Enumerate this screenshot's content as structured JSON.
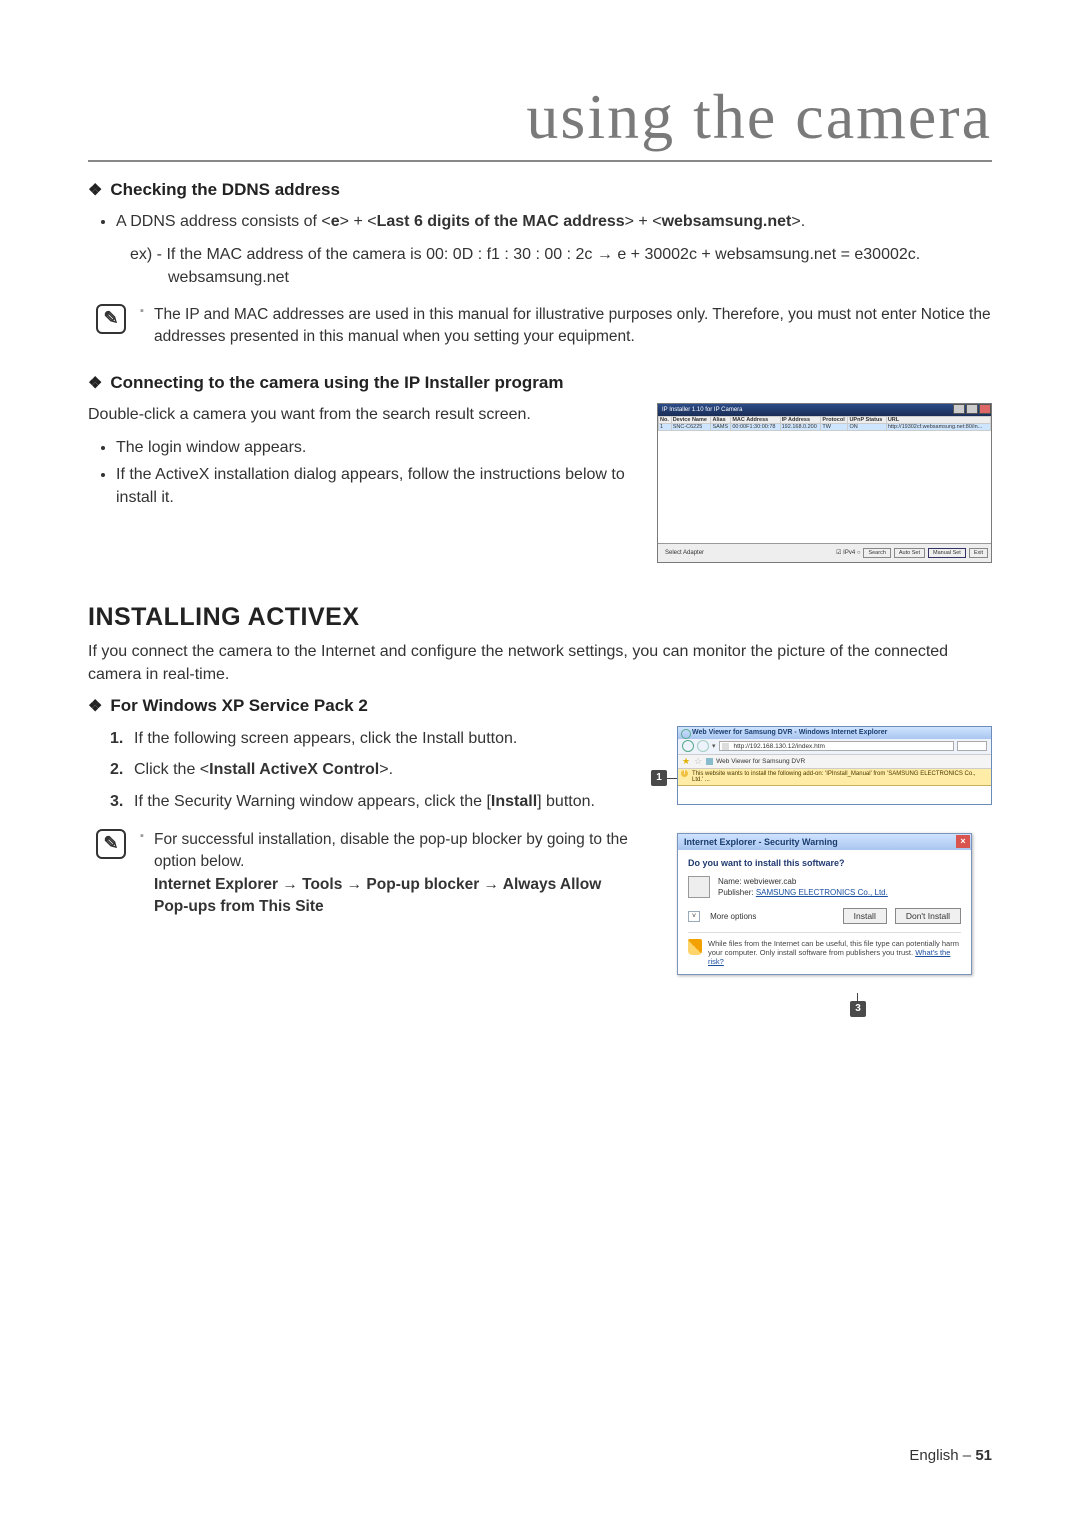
{
  "page": {
    "title": "using the camera",
    "footer_lang": "English –",
    "footer_page": "51"
  },
  "section_ddns": {
    "heading": "Checking the DDNS address",
    "bullet1_pre": "A DDNS address consists of <",
    "bullet1_e": "e",
    "bullet1_mid1": "> + <",
    "bullet1_last6": "Last 6 digits of the MAC address",
    "bullet1_mid2": "> + <",
    "bullet1_domain": "websamsung.net",
    "bullet1_post": ">.",
    "ex_line1": "ex) - If the MAC address of the camera is 00: 0D : f1 : 30 : 00 : 2c → e + 30002c + websamsung.net = e30002c.",
    "ex_line2": "websamsung.net",
    "note": "The IP and MAC addresses are used in this manual for illustrative purposes only. Therefore, you must not enter Notice the addresses presented in this manual when you setting your equipment."
  },
  "section_connect": {
    "heading": "Connecting to the camera using the IP Installer program",
    "para": "Double-click a camera you want from the search result screen.",
    "b1": "The login window appears.",
    "b2": "If the ActiveX installation dialog appears, follow the instructions below to install it."
  },
  "section_install": {
    "heading": "INSTALLING ACTIVEX",
    "intro": "If you connect the camera to the Internet and configure the network settings, you can monitor the picture of the connected camera in real-time.",
    "sub": "For Windows XP Service Pack 2",
    "step1": "If the following screen appears, click the Install button.",
    "step2_pre": "Click the <",
    "step2_bold": "Install ActiveX Control",
    "step2_post": ">.",
    "step3_pre": "If the Security Warning window appears, click the [",
    "step3_bold": "Install",
    "step3_post": "] button.",
    "note1": "For successful installation, disable the pop-up blocker by going to the option below.",
    "note_path": "Internet Explorer → Tools → Pop-up blocker → Always Allow Pop-ups from This Site"
  },
  "fig_ipinstaller": {
    "title": "IP Installer 1.10 for IP Camera",
    "cols": [
      "No.",
      "Device Name",
      "Alias",
      "MAC Address",
      "IP Address",
      "Protocol",
      "UPnP Status",
      "URL"
    ],
    "row": [
      "1",
      "SNC-C6225",
      "SAMS",
      "00:00F1:30:00:78",
      "192.168.0.200",
      "TW",
      "ON",
      "http://19302cf.websamsung.net:80/in..."
    ],
    "footer_left": "Select Adapter",
    "radio": "☑ IPv4  ○",
    "btn_search": "Search",
    "btn_auto": "Auto Set",
    "btn_manual": "Manual Set",
    "btn_exit": "Exit"
  },
  "fig_ie": {
    "title": "Web Viewer for Samsung DVR - Windows Internet Explorer",
    "addr": "http://192.168.130.12/index.htm",
    "tab": "Web Viewer for Samsung DVR",
    "infobar": "This website wants to install the following add-on: 'IPInstall_Manual' from 'SAMSUNG ELECTRONICS Co., Ltd.' ...",
    "callout": "1"
  },
  "fig_sec": {
    "title": "Internet Explorer - Security Warning",
    "question": "Do you want to install this software?",
    "name_label": "Name:",
    "name_value": "webviewer.cab",
    "pub_label": "Publisher:",
    "pub_value": "SAMSUNG ELECTRONICS Co., Ltd.",
    "more_symbol": "˅",
    "more": "More options",
    "btn_install": "Install",
    "btn_dont": "Don't Install",
    "warn": "While files from the Internet can be useful, this file type can potentially harm your computer. Only install software from publishers you trust.",
    "warn_link": "What's the risk?",
    "callout": "3"
  }
}
